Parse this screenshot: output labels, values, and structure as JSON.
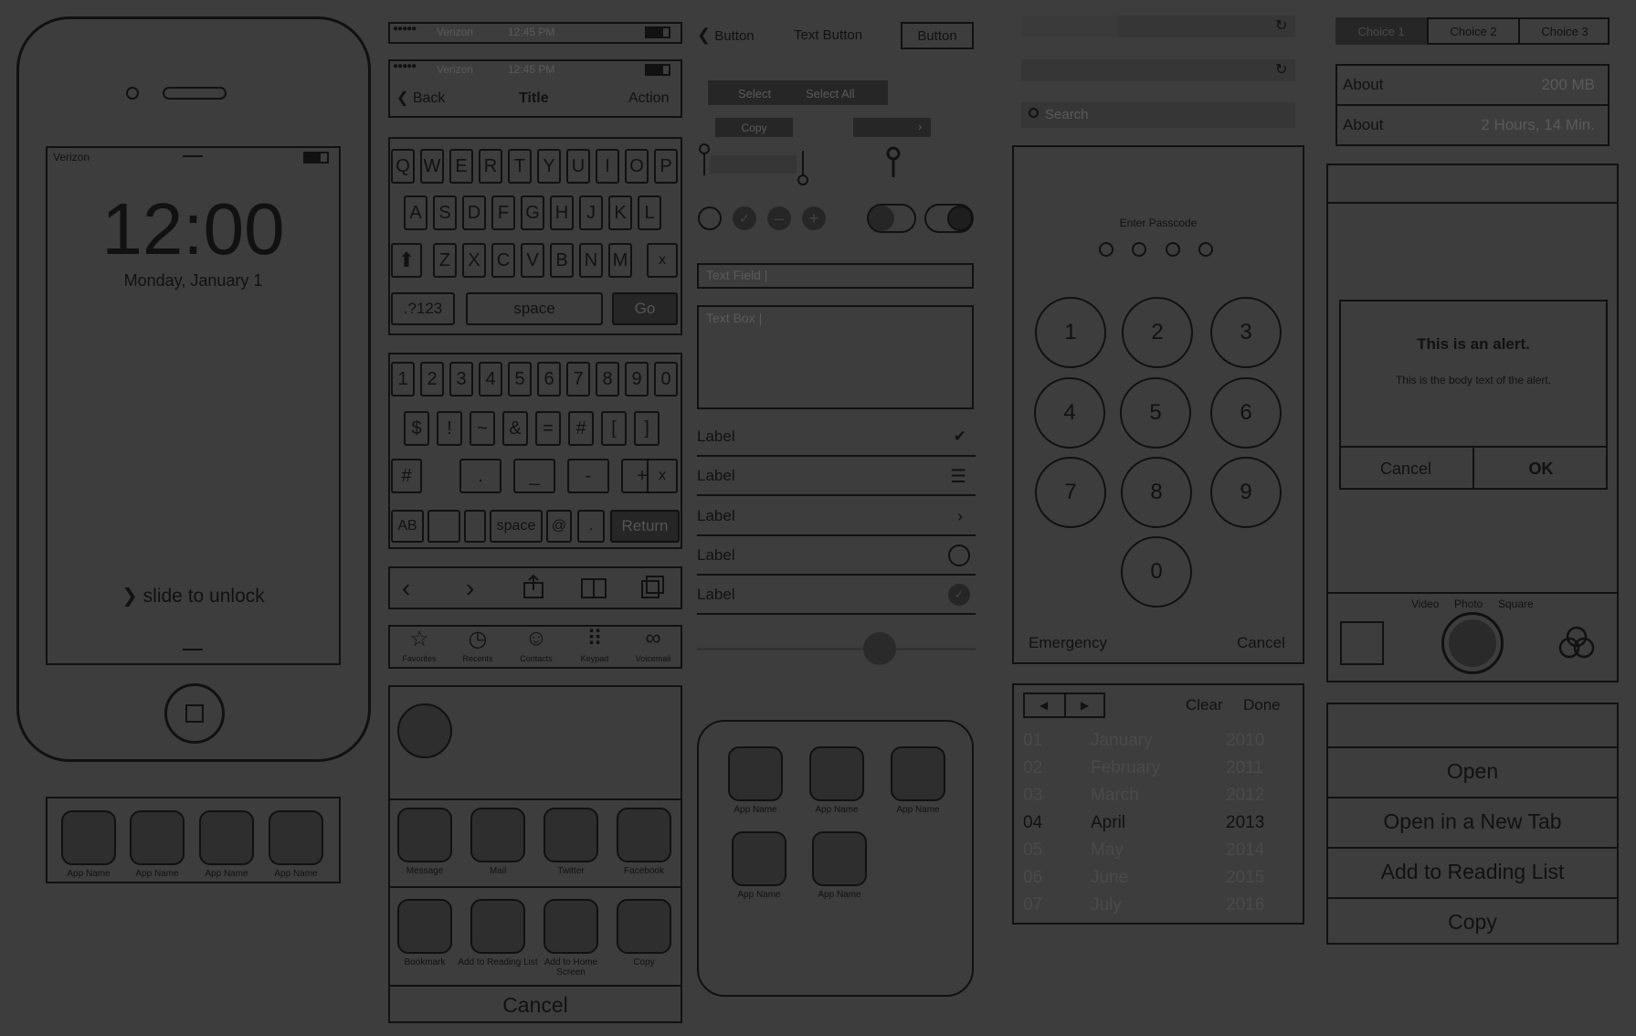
{
  "lockscreen": {
    "carrier": "Verizon",
    "time": "12:00",
    "date": "Monday, January 1",
    "slide": "slide to unlock",
    "dock": [
      "App Name",
      "App Name",
      "App Name",
      "App Name"
    ]
  },
  "statusbar": {
    "carrier": "Verizon",
    "time": "12:45 PM"
  },
  "navbar": {
    "back": "Back",
    "title": "Title",
    "action": "Action"
  },
  "keyboard_alpha": {
    "row1": [
      "Q",
      "W",
      "E",
      "R",
      "T",
      "Y",
      "U",
      "I",
      "O",
      "P"
    ],
    "row2": [
      "A",
      "S",
      "D",
      "F",
      "G",
      "H",
      "J",
      "K",
      "L"
    ],
    "row3": [
      "Z",
      "X",
      "C",
      "V",
      "B",
      "N",
      "M"
    ],
    "delete": "x",
    "num": ".?123",
    "space": "space",
    "go": "Go"
  },
  "keyboard_num": {
    "row1": [
      "1",
      "2",
      "3",
      "4",
      "5",
      "6",
      "7",
      "8",
      "9",
      "0"
    ],
    "row2": [
      "$",
      "!",
      "~",
      "&",
      "=",
      "#",
      "[",
      "]"
    ],
    "row3": [
      "#",
      ".",
      "_",
      "-",
      "+"
    ],
    "delete": "x",
    "ab": "AB",
    "space": "space",
    "at": "@",
    "dot": ".",
    "return": "Return"
  },
  "tabbar": [
    "Favorites",
    "Recents",
    "Contacts",
    "Keypad",
    "Voicemail"
  ],
  "share": {
    "row1": [
      "Message",
      "Mail",
      "Twitter",
      "Facebook"
    ],
    "row2": [
      "Bookmark",
      "Add to Reading List",
      "Add to Home Screen",
      "Copy"
    ],
    "cancel": "Cancel"
  },
  "controls": {
    "button": "Button",
    "text_button": "Text Button",
    "bordered_button": "Button",
    "select": "Select",
    "select_all": "Select All",
    "copy": "Copy",
    "text_field": "Text Field |",
    "text_box": "Text Box |",
    "labels": [
      "Label",
      "Label",
      "Label",
      "Label",
      "Label"
    ]
  },
  "folder": [
    "App Name",
    "App Name",
    "App Name",
    "App Name",
    "App Name"
  ],
  "search": {
    "placeholder": "Search"
  },
  "passcode": {
    "title": "Enter Passcode",
    "keys": [
      "1",
      "2",
      "3",
      "4",
      "5",
      "6",
      "7",
      "8",
      "9",
      "0"
    ],
    "emergency": "Emergency",
    "cancel": "Cancel"
  },
  "picker": {
    "clear": "Clear",
    "done": "Done",
    "rows": [
      {
        "d": "01",
        "m": "January",
        "y": "2010"
      },
      {
        "d": "02",
        "m": "February",
        "y": "2011"
      },
      {
        "d": "03",
        "m": "March",
        "y": "2012"
      },
      {
        "d": "04",
        "m": "April",
        "y": "2013"
      },
      {
        "d": "05",
        "m": "May",
        "y": "2014"
      },
      {
        "d": "06",
        "m": "June",
        "y": "2015"
      },
      {
        "d": "07",
        "m": "July",
        "y": "2016"
      }
    ]
  },
  "segmented": [
    "Choice 1",
    "Choice 2",
    "Choice 3"
  ],
  "info": [
    {
      "label": "About",
      "value": "200 MB"
    },
    {
      "label": "About",
      "value": "2 Hours, 14 Min."
    }
  ],
  "alert": {
    "title": "This is an alert.",
    "body": "This is the body text of the alert.",
    "cancel": "Cancel",
    "ok": "OK"
  },
  "camera": {
    "modes": [
      "Video",
      "Photo",
      "Square"
    ]
  },
  "actionsheet": [
    "Open",
    "Open in a New Tab",
    "Add to Reading List",
    "Copy"
  ]
}
